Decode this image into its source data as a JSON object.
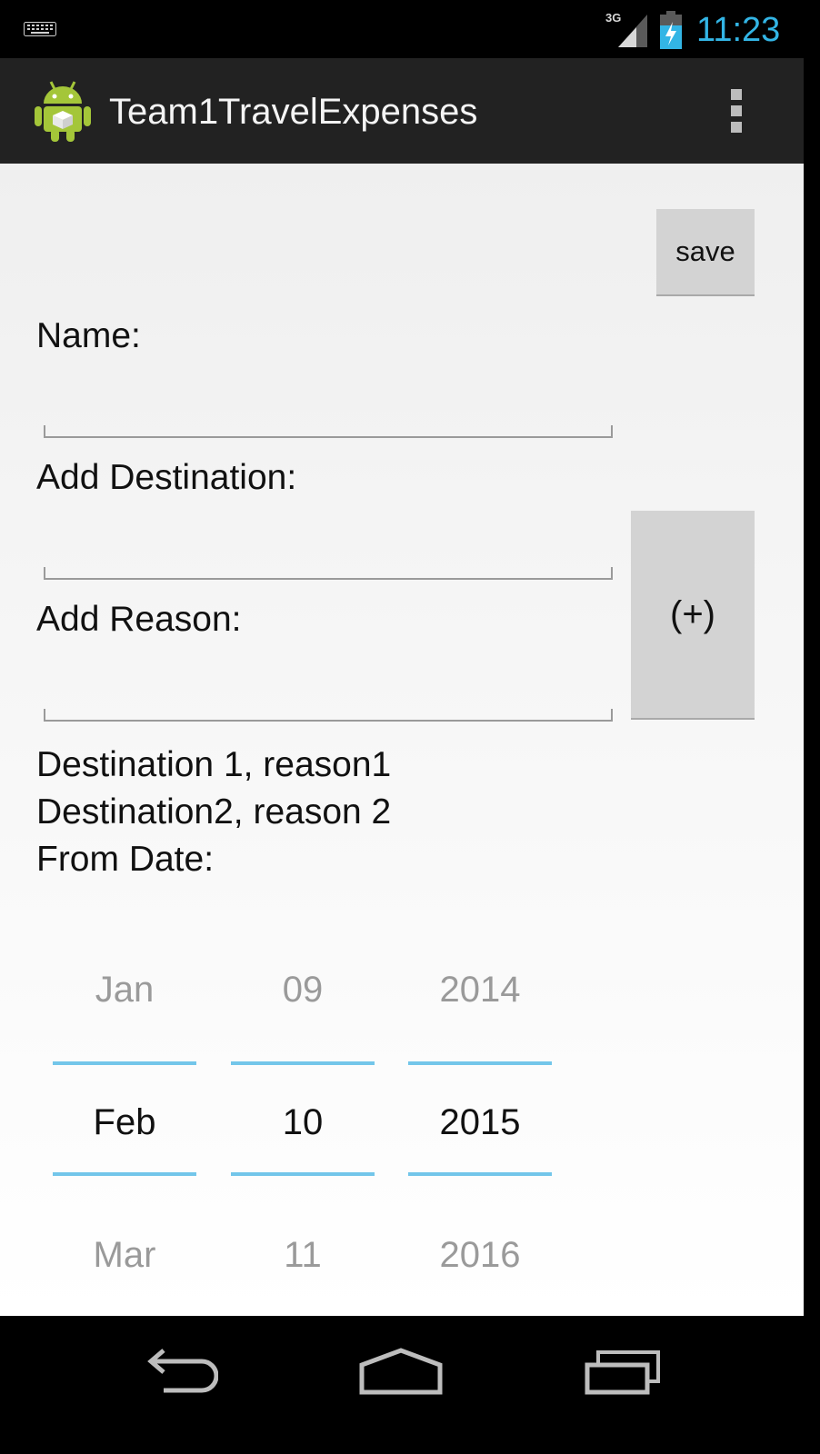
{
  "status_bar": {
    "network": "3G",
    "time": "11:23"
  },
  "action_bar": {
    "title": "Team1TravelExpenses"
  },
  "form": {
    "save_label": "save",
    "name_label": "Name:",
    "name_value": "",
    "destination_label": "Add Destination:",
    "destination_value": "",
    "reason_label": "Add Reason:",
    "reason_value": "",
    "add_label": "(+)"
  },
  "destinations": [
    "Destination 1, reason1",
    "Destination2, reason 2"
  ],
  "from_date": {
    "label": "From Date:",
    "month": {
      "prev": "Jan",
      "current": "Feb",
      "next": "Mar"
    },
    "day": {
      "prev": "09",
      "current": "10",
      "next": "11"
    },
    "year": {
      "prev": "2014",
      "current": "2015",
      "next": "2016"
    }
  },
  "nav_icons": [
    "back-icon",
    "home-icon",
    "recent-apps-icon"
  ],
  "colors": {
    "accent": "#33b5e5",
    "picker_line": "#73c6ea",
    "action_bar": "#222222",
    "button": "#d3d3d3"
  }
}
